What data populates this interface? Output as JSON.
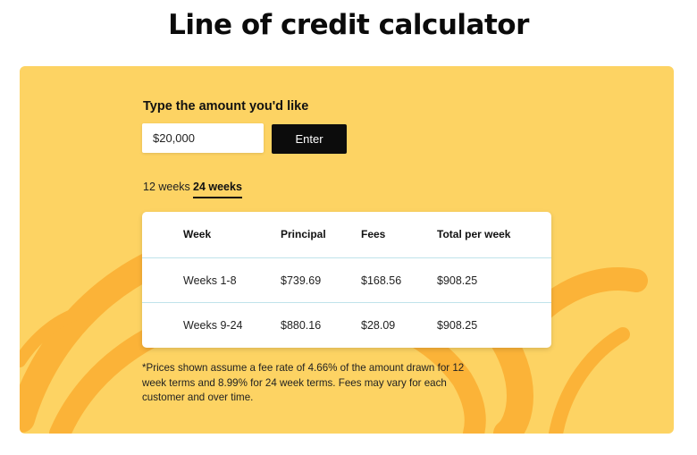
{
  "page": {
    "title": "Line of credit calculator"
  },
  "calculator": {
    "amount_label": "Type the amount you'd like",
    "amount_value": "$20,000",
    "enter_label": "Enter",
    "tabs": [
      {
        "label": "12 weeks",
        "active": false
      },
      {
        "label": "24 weeks",
        "active": true
      }
    ],
    "table": {
      "headers": [
        "Week",
        "Principal",
        "Fees",
        "Total per week"
      ],
      "rows": [
        [
          "Weeks 1-8",
          "$739.69",
          "$168.56",
          "$908.25"
        ],
        [
          "Weeks 9-24",
          "$880.16",
          "$28.09",
          "$908.25"
        ]
      ]
    },
    "footnote": "*Prices shown assume a fee rate of 4.66% of the amount drawn for 12 week terms and 8.99% for 24 week terms. Fees may vary for each customer and over time."
  },
  "colors": {
    "panel_background": "#fdd363",
    "swirl": "#fbb034",
    "button": "#0c0c0c",
    "row_divider": "#bfe3ea"
  }
}
